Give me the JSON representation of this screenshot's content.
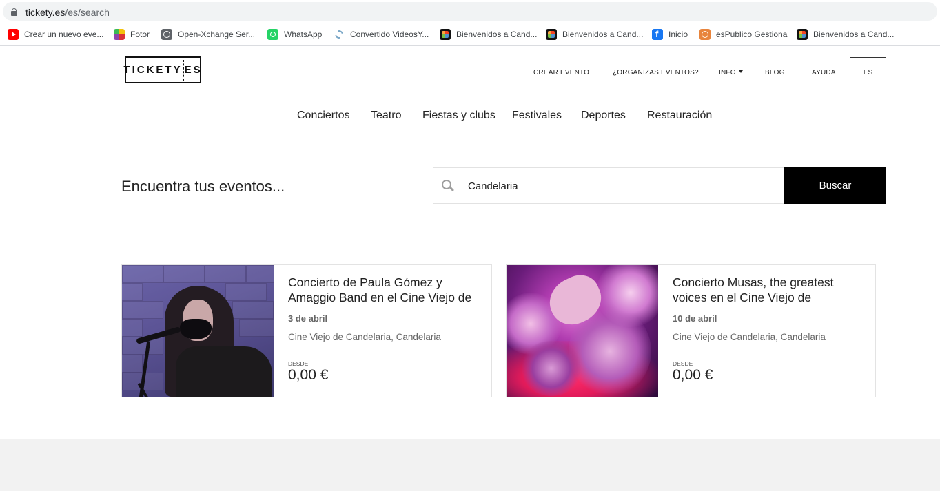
{
  "browser": {
    "url_domain": "tickety.es",
    "url_path": "/es/search",
    "bookmarks": [
      {
        "label": "Crear un nuevo eve...",
        "icon": "youtube-icon"
      },
      {
        "label": "Fotor",
        "icon": "fotor-icon"
      },
      {
        "label": "Open-Xchange Ser...",
        "icon": "globe-icon"
      },
      {
        "label": "WhatsApp",
        "icon": "whatsapp-icon"
      },
      {
        "label": "Convertido VideosY...",
        "icon": "convert-icon"
      },
      {
        "label": "Bienvenidos a Cand...",
        "icon": "joomla-icon"
      },
      {
        "label": "Bienvenidos a Cand...",
        "icon": "joomla-icon"
      },
      {
        "label": "Inicio",
        "icon": "facebook-icon"
      },
      {
        "label": "esPublico Gestiona",
        "icon": "espublico-icon"
      },
      {
        "label": "Bienvenidos a Cand...",
        "icon": "joomla-icon"
      }
    ]
  },
  "header": {
    "logo_left": "TICKETY",
    "logo_right": "ES",
    "nav": {
      "crear_evento": "CREAR EVENTO",
      "organizas": "¿ORGANIZAS EVENTOS?",
      "info": "INFO",
      "blog": "BLOG",
      "ayuda": "AYUDA",
      "lang": "ES"
    }
  },
  "categories": [
    "Conciertos",
    "Teatro",
    "Fiestas y clubs",
    "Festivales",
    "Deportes",
    "Restauración"
  ],
  "search": {
    "title": "Encuentra tus eventos...",
    "value": "Candelaria",
    "button": "Buscar"
  },
  "events": [
    {
      "title": "Concierto de Paula Gómez y Amaggio Band en el Cine Viejo de",
      "date": "3 de abril",
      "venue": "Cine Viejo de Candelaria, Candelaria",
      "from_label": "DESDE",
      "price": "0,00 €"
    },
    {
      "title": "Concierto Musas, the greatest voices en el Cine Viejo de",
      "date": "10 de abril",
      "venue": "Cine Viejo de Candelaria, Candelaria",
      "from_label": "DESDE",
      "price": "0,00 €"
    }
  ]
}
